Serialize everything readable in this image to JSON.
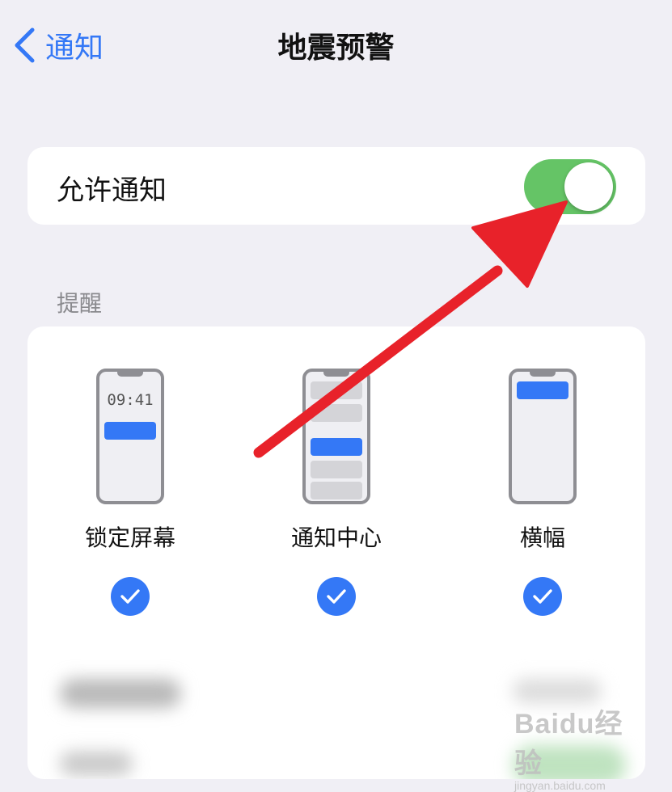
{
  "nav": {
    "back_label": "通知",
    "title": "地震预警"
  },
  "allow": {
    "label": "允许通知",
    "toggle_on": true,
    "toggle_color": "#65c466"
  },
  "alerts": {
    "section_title": "提醒",
    "options": [
      {
        "label": "锁定屏幕",
        "checked": true,
        "preview_time": "09:41"
      },
      {
        "label": "通知中心",
        "checked": true
      },
      {
        "label": "横幅",
        "checked": true
      }
    ]
  },
  "colors": {
    "accent": "#3478f6",
    "annotation_arrow": "#e8222a",
    "background": "#f0eff5"
  },
  "watermark": {
    "logo": "Baidu经验",
    "sub": "jingyan.baidu.com"
  }
}
